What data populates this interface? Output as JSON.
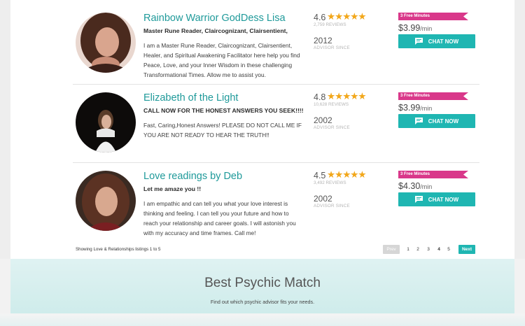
{
  "listings": [
    {
      "name": "Rainbow Warrior GodDess Lisa",
      "tagline": "Master Rune Reader, Claircognizant, Clairsentient,",
      "description": "I am a Master Rune Reader, Claircognizant, Clairsentient, Healer, and Spiritual Awakening Facilitator here help you find Peace, Love, and your Inner Wisdom in these challenging Transformational Times. Allow me to assist you.",
      "rating": "4.6",
      "stars": "★★★★★",
      "reviews": "2,759 REVIEWS",
      "advisor_year": "2012",
      "advisor_since_label": "ADVISOR SINCE",
      "free_minutes": "3 Free Minutes",
      "price": "$3.99",
      "price_unit": "/min",
      "chat_label": "CHAT NOW",
      "photo_icon": "advisor-photo"
    },
    {
      "name": "Elizabeth of the Light",
      "tagline": "CALL NOW FOR THE HONEST ANSWERS YOU SEEK!!!!",
      "description": "Fast, Caring,Honest Answers! PLEASE DO NOT CALL ME IF YOU ARE NOT READY TO HEAR THE TRUTH!!",
      "rating": "4.8",
      "stars": "★★★★★",
      "reviews": "10,628 REVIEWS",
      "advisor_year": "2002",
      "advisor_since_label": "ADVISOR SINCE",
      "free_minutes": "3 Free Minutes",
      "price": "$3.99",
      "price_unit": "/min",
      "chat_label": "CHAT NOW",
      "photo_icon": "advisor-photo"
    },
    {
      "name": "Love readings by Deb",
      "tagline": "Let me amaze you !!",
      "description": "I am empathic and can tell you what your love interest is thinking and feeling. I can tell you your future and how to reach your relationship and career goals. I will astonish you with my accuracy and time frames. Call me!",
      "rating": "4.5",
      "stars": "★★★★★",
      "reviews": "3,492 REVIEWS",
      "advisor_year": "2002",
      "advisor_since_label": "ADVISOR SINCE",
      "free_minutes": "3 Free Minutes",
      "price": "$4.30",
      "price_unit": "/min",
      "chat_label": "CHAT NOW",
      "photo_icon": "advisor-photo"
    }
  ],
  "footer": {
    "showing": "Showing Love & Relationships listings 1 to 5"
  },
  "pagination": {
    "prev": "Prev",
    "pages": [
      "1",
      "2",
      "3",
      "4",
      "5"
    ],
    "current": "4",
    "next": "Next"
  },
  "match": {
    "title": "Best Psychic Match",
    "subtitle": "Find out which psychic advisor fits your needs."
  },
  "colors": {
    "accent": "#1fb6b2",
    "name": "#1f9a9a",
    "badge": "#d9388a",
    "star": "#f2a71a"
  }
}
